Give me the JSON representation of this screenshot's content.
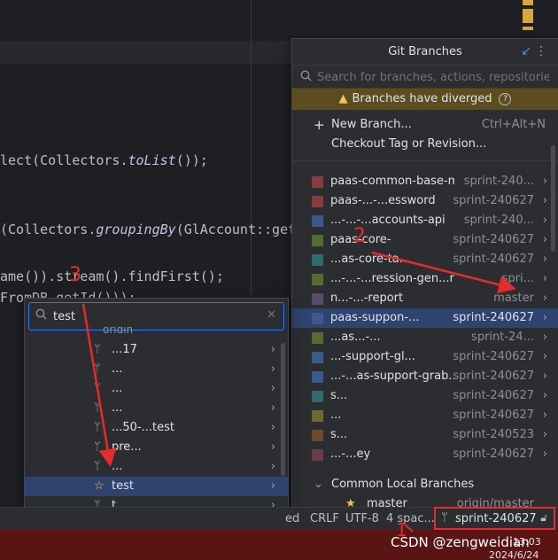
{
  "editor": {
    "lines": [
      {
        "pre": "lect(Collectors.",
        "italic": "toList",
        "post": "());"
      },
      {
        "pre": "(Collectors.",
        "italic": "groupingBy",
        "post": "(GlAccount::getB"
      },
      {
        "pre": "ame()).stream().findFirst();",
        "italic": "",
        "post": ""
      },
      {
        "pre": "FromDB.getId()));",
        "italic": "",
        "post": ""
      }
    ]
  },
  "git_branches": {
    "title": "Git Branches",
    "search_placeholder": "Search for branches, actions, repositories",
    "warning": "Branches have diverged",
    "help_glyph": "?",
    "actions": [
      {
        "label": "New Branch...",
        "shortcut": "Ctrl+Alt+N"
      },
      {
        "label": "Checkout Tag or Revision...",
        "shortcut": ""
      }
    ],
    "branches": [
      {
        "name": "paas-common-base-mini",
        "track": "sprint-240...",
        "color": "#8a3c3c"
      },
      {
        "name": "paas-...-...essword",
        "track": "sprint-240627",
        "color": "#8a3c3c"
      },
      {
        "name": "...-...-...accounts-api",
        "track": "sprint-240...",
        "color": "#3b5a8c"
      },
      {
        "name": "paas-core-",
        "track": "sprint-240627",
        "color": "#556b2f"
      },
      {
        "name": "...as-core-ta...",
        "track": "sprint-240627",
        "color": "#2f6b6b"
      },
      {
        "name": "...-...-...ression-gen...r",
        "track": "spri...",
        "color": "#556b2f"
      },
      {
        "name": "n...-...-report",
        "track": "master",
        "color": "#5a4a6b"
      },
      {
        "name": "paas-suppon-...",
        "track": "sprint-240627",
        "color": "#3b5a8c",
        "selected": true
      },
      {
        "name": "...as...-...",
        "track": "sprint-24...",
        "color": "#556b2f"
      },
      {
        "name": "...-support-gl...",
        "track": "sprint-240627",
        "color": "#3b5a8c"
      },
      {
        "name": "...-...as-support-grab...",
        "track": "sprint-240627",
        "color": "#3b5a8c"
      },
      {
        "name": "s...",
        "track": "sprint-240627",
        "color": "#2f6b6b"
      },
      {
        "name": "...",
        "track": "sprint-240627",
        "color": "#6b6b2f"
      },
      {
        "name": "s...",
        "track": "sprint-240523",
        "color": "#6b4a2f"
      },
      {
        "name": "...-...ey",
        "track": "sprint-240627",
        "color": "#6b3c4a"
      }
    ],
    "local_group": "Common Local Branches",
    "local_branches": [
      {
        "name": "master",
        "track": "origin/master"
      }
    ]
  },
  "branch_filter": {
    "query": "test",
    "origin_hint": "origin",
    "rows": [
      {
        "name": "...17",
        "selected": false
      },
      {
        "name": "...",
        "selected": false
      },
      {
        "name": "...",
        "selected": false
      },
      {
        "name": "...",
        "selected": false
      },
      {
        "name": "...50-...test",
        "selected": false
      },
      {
        "name": "pre...",
        "selected": false
      },
      {
        "name": "...",
        "selected": false
      },
      {
        "name": "test",
        "selected": true
      },
      {
        "name": "t...",
        "selected": false
      },
      {
        "name": "te...",
        "selected": false
      }
    ]
  },
  "statusbar": {
    "items": [
      "ed",
      "CRLF",
      "UTF-8",
      "4 spac..."
    ],
    "branch": "sprint-240627"
  },
  "taskbar": {
    "watermark": "CSDN @zengweidian",
    "time": "13:03",
    "date": "2024/6/24"
  },
  "annotations": {
    "one": "1",
    "two": "2",
    "three": "3",
    "color": "#e52b2b"
  }
}
